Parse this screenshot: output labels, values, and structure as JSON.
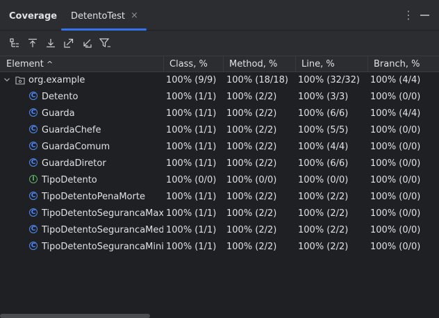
{
  "tabs": [
    {
      "label": "Coverage"
    },
    {
      "label": "DetentoTest"
    }
  ],
  "toolbar": {
    "buttons": [
      "flatten-packages-icon",
      "go-up-icon",
      "go-down-icon",
      "export-icon",
      "import-icon",
      "filter-icon"
    ]
  },
  "columns": [
    "Element",
    "Class, %",
    "Method, %",
    "Line, %",
    "Branch, %"
  ],
  "package": {
    "name": "org.example",
    "class": "100% (9/9)",
    "method": "100% (18/18)",
    "line": "100% (32/32)",
    "branch": "100% (4/4)"
  },
  "rows": [
    {
      "name": "Detento",
      "type": "class",
      "class": "100% (1/1)",
      "method": "100% (2/2)",
      "line": "100% (3/3)",
      "branch": "100% (0/0)"
    },
    {
      "name": "Guarda",
      "type": "class",
      "class": "100% (1/1)",
      "method": "100% (2/2)",
      "line": "100% (6/6)",
      "branch": "100% (4/4)"
    },
    {
      "name": "GuardaChefe",
      "type": "class",
      "class": "100% (1/1)",
      "method": "100% (2/2)",
      "line": "100% (5/5)",
      "branch": "100% (0/0)"
    },
    {
      "name": "GuardaComum",
      "type": "class",
      "class": "100% (1/1)",
      "method": "100% (2/2)",
      "line": "100% (4/4)",
      "branch": "100% (0/0)"
    },
    {
      "name": "GuardaDiretor",
      "type": "class",
      "class": "100% (1/1)",
      "method": "100% (2/2)",
      "line": "100% (6/6)",
      "branch": "100% (0/0)"
    },
    {
      "name": "TipoDetento",
      "type": "enum",
      "class": "100% (0/0)",
      "method": "100% (0/0)",
      "line": "100% (0/0)",
      "branch": "100% (0/0)"
    },
    {
      "name": "TipoDetentoPenaMorte",
      "type": "class",
      "class": "100% (1/1)",
      "method": "100% (2/2)",
      "line": "100% (2/2)",
      "branch": "100% (0/0)"
    },
    {
      "name": "TipoDetentoSegurancaMaxi",
      "type": "class",
      "class": "100% (1/1)",
      "method": "100% (2/2)",
      "line": "100% (2/2)",
      "branch": "100% (0/0)"
    },
    {
      "name": "TipoDetentoSegurancaMedi",
      "type": "class",
      "class": "100% (1/1)",
      "method": "100% (2/2)",
      "line": "100% (2/2)",
      "branch": "100% (0/0)"
    },
    {
      "name": "TipoDetentoSegurancaMinir",
      "type": "class",
      "class": "100% (1/1)",
      "method": "100% (2/2)",
      "line": "100% (2/2)",
      "branch": "100% (0/0)"
    }
  ]
}
